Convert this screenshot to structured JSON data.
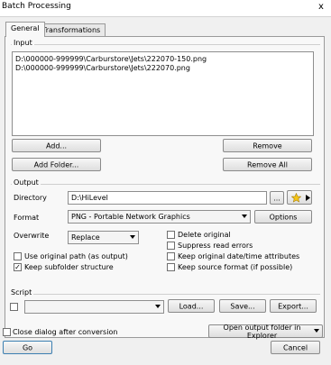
{
  "window": {
    "title": "Batch Processing",
    "close_glyph": "x"
  },
  "tabs": [
    {
      "label": "General"
    },
    {
      "label": "Transformations"
    }
  ],
  "input": {
    "group_label": "Input",
    "files": [
      "D:\\000000-999999\\Carburstore\\Jets\\222070-150.png",
      "D:\\000000-999999\\Carburstore\\Jets\\222070.png"
    ],
    "add_label": "Add...",
    "remove_label": "Remove",
    "add_folder_label": "Add Folder...",
    "remove_all_label": "Remove All"
  },
  "output": {
    "group_label": "Output",
    "directory_label": "Directory",
    "directory_value": "D:\\HiLevel",
    "browse_label": "...",
    "favorites_icon": "star-folder-icon",
    "format_label": "Format",
    "format_value": "PNG - Portable Network Graphics",
    "options_label": "Options",
    "overwrite_label": "Overwrite",
    "overwrite_value": "Replace",
    "checkboxes_left": [
      {
        "label": "Use original path (as output)",
        "checked": false
      },
      {
        "label": "Keep subfolder structure",
        "checked": true
      }
    ],
    "checkboxes_right": [
      {
        "label": "Delete original",
        "checked": false
      },
      {
        "label": "Suppress read errors",
        "checked": false
      },
      {
        "label": "Keep original date/time attributes",
        "checked": false
      },
      {
        "label": "Keep source format (if possible)",
        "checked": false
      }
    ]
  },
  "script": {
    "group_label": "Script",
    "enabled": false,
    "selected_value": "",
    "load_label": "Load...",
    "save_label": "Save...",
    "export_label": "Export..."
  },
  "footer": {
    "close_dialog_label": "Close dialog after conversion",
    "close_dialog_checked": false,
    "open_output_label": "Open output folder in Explorer",
    "go_label": "Go",
    "cancel_label": "Cancel"
  },
  "colors": {
    "window_bg": "#f0f0f0",
    "panel_bg": "#f8f8f8",
    "border": "#8e8e8e"
  }
}
